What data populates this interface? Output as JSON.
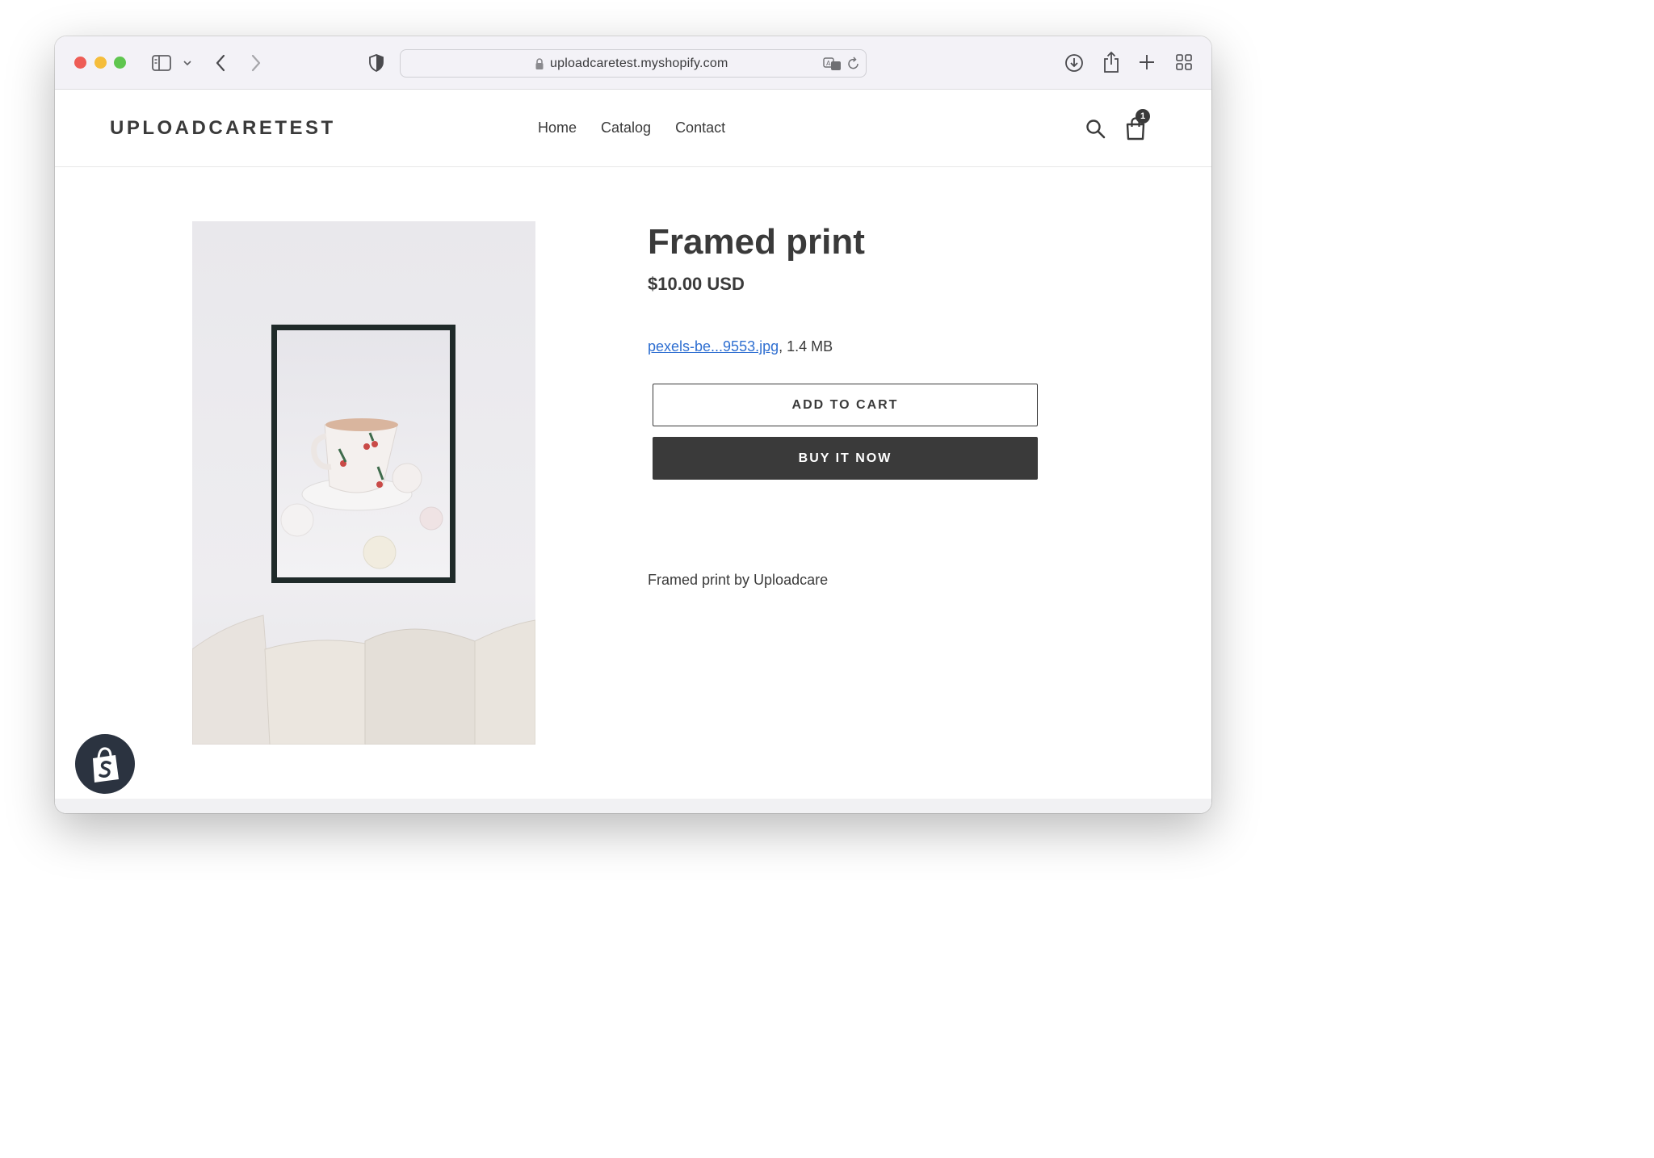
{
  "browser": {
    "url": "uploadcaretest.myshopify.com"
  },
  "store": {
    "name": "UPLOADCARETEST",
    "nav": [
      "Home",
      "Catalog",
      "Contact"
    ],
    "cart_count": "1"
  },
  "product": {
    "title": "Framed print",
    "price": "$10.00 USD",
    "file_name": "pexels-be...9553.jpg",
    "file_size": ", 1.4 MB",
    "add_to_cart_label": "ADD TO CART",
    "buy_now_label": "BUY IT NOW",
    "description": "Framed print by Uploadcare"
  },
  "colors": {
    "text": "#3a3a3a",
    "link": "#2f6fd1",
    "buy_button_bg": "#3a3a3a",
    "shopify_badge_bg": "#2b3340"
  }
}
